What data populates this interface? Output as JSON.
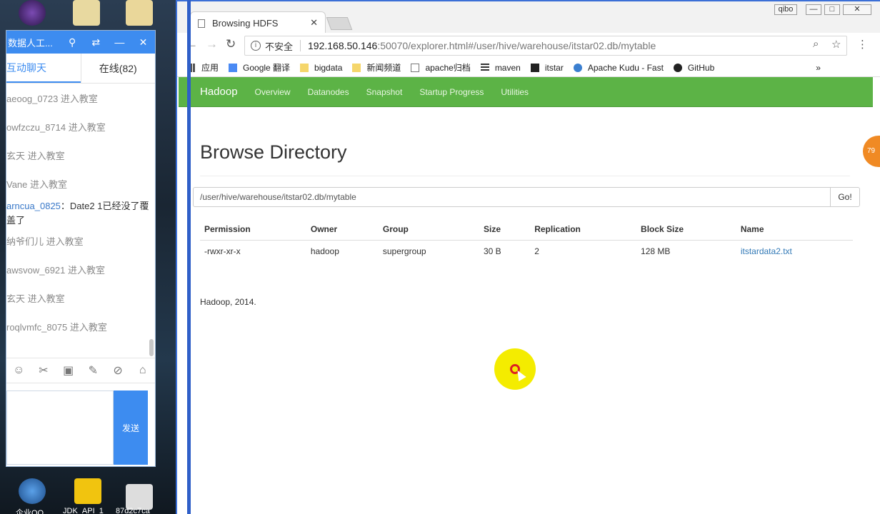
{
  "desktop": {
    "taskbar_labels": [
      "企业QQ",
      "JDK_API_1",
      "87d2c7ca"
    ]
  },
  "chat": {
    "title": "数据人工...",
    "tabs": {
      "interactive": "互动聊天",
      "online": "在线(82)"
    },
    "messages": [
      "aeoog_0723 进入教室",
      "owfzczu_8714 进入教室",
      "玄天 进入教室",
      "Vane 进入教室",
      {
        "user": "arncua_0825",
        "text": "：Date2 1已经没了覆盖了"
      },
      "纳爷们儿 进入教室",
      "awsvow_6921 进入教室",
      "玄天 进入教室",
      "roqlvmfc_8075 进入教室"
    ],
    "send_label": "发送"
  },
  "browser": {
    "tab_title": "Browsing HDFS",
    "address": {
      "security": "不安全",
      "host": "192.168.50.146",
      "path": ":50070/explorer.html#/user/hive/warehouse/itstar02.db/mytable"
    },
    "bookmarks": [
      "应用",
      "Google 翻译",
      "bigdata",
      "新闻频道",
      "apache归档",
      "maven",
      "itstar",
      "Apache Kudu - Fast",
      "GitHub"
    ],
    "window_badge": "qibo"
  },
  "page": {
    "nav": {
      "brand": "Hadoop",
      "links": [
        "Overview",
        "Datanodes",
        "Snapshot",
        "Startup Progress",
        "Utilities"
      ]
    },
    "heading": "Browse Directory",
    "path_value": "/user/hive/warehouse/itstar02.db/mytable",
    "go_label": "Go!",
    "table": {
      "headers": [
        "Permission",
        "Owner",
        "Group",
        "Size",
        "Replication",
        "Block Size",
        "Name"
      ],
      "rows": [
        [
          "-rwxr-xr-x",
          "hadoop",
          "supergroup",
          "30 B",
          "2",
          "128 MB",
          "itstardata2.txt"
        ]
      ]
    },
    "footer": "Hadoop, 2014.",
    "side_badge": "79"
  }
}
